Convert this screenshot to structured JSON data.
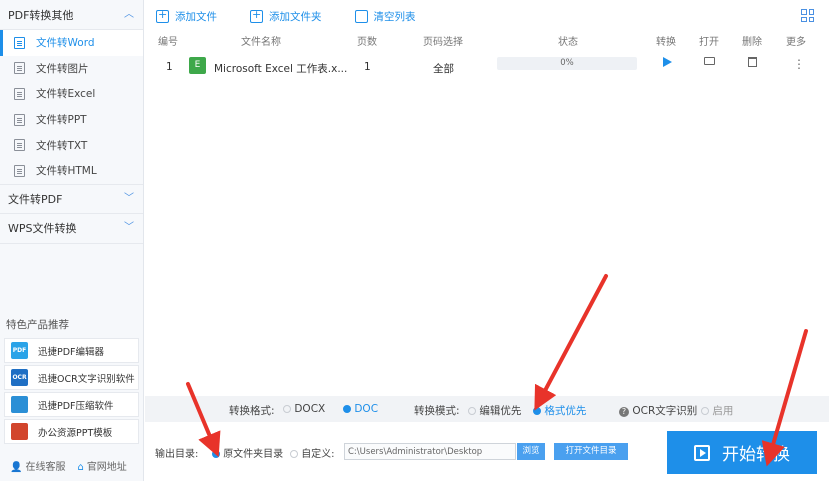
{
  "sidebar": {
    "sections": [
      {
        "label": "PDF转换其他",
        "expanded": true
      },
      {
        "label": "文件转PDF",
        "expanded": false
      },
      {
        "label": "WPS文件转换",
        "expanded": false
      }
    ],
    "items": [
      {
        "label": "文件转Word",
        "active": true
      },
      {
        "label": "文件转图片"
      },
      {
        "label": "文件转Excel"
      },
      {
        "label": "文件转PPT"
      },
      {
        "label": "文件转TXT"
      },
      {
        "label": "文件转HTML"
      }
    ],
    "featured_title": "特色产品推荐",
    "featured": [
      {
        "label": "迅捷PDF编辑器",
        "icon": "pdf-editor-icon",
        "color": "#2aa3e8",
        "badge": "PDF"
      },
      {
        "label": "迅捷OCR文字识别软件",
        "icon": "ocr-icon",
        "color": "#1f6fc4",
        "badge": "OCR"
      },
      {
        "label": "迅捷PDF压缩软件",
        "icon": "pdf-compress-icon",
        "color": "#2b8fd6",
        "badge": ""
      },
      {
        "label": "办公资源PPT模板",
        "icon": "ppt-template-icon",
        "color": "#d2452c",
        "badge": ""
      }
    ],
    "support": "在线客服",
    "website": "官网地址"
  },
  "toolbar": {
    "add_file": "添加文件",
    "add_folder": "添加文件夹",
    "clear_list": "清空列表"
  },
  "table": {
    "headers": [
      "编号",
      "文件名称",
      "页数",
      "页码选择",
      "状态",
      "转换",
      "打开",
      "删除",
      "更多"
    ],
    "rows": [
      {
        "index": "1",
        "icon_letter": "E",
        "name": "Microsoft Excel 工作表.x...",
        "pages": "1",
        "page_select": "全部",
        "progress": "0%"
      }
    ]
  },
  "options": {
    "format_label": "转换格式:",
    "format_options": [
      "DOCX",
      "DOC"
    ],
    "format_selected": "DOC",
    "mode_label": "转换模式:",
    "mode_options": [
      "编辑优先",
      "格式优先"
    ],
    "mode_selected": "格式优先",
    "ocr_label": "OCR文字识别",
    "ocr_enable": "启用"
  },
  "output": {
    "label": "输出目录:",
    "original_folder": "原文件夹目录",
    "custom": "自定义:",
    "path": "C:\\Users\\Administrator\\Desktop",
    "browse": "浏览",
    "open_folder": "打开文件目录"
  },
  "start_button": "开始转换",
  "colors": {
    "accent": "#1e8fe9",
    "excel": "#3ea84a",
    "arrow": "#e8332a"
  }
}
